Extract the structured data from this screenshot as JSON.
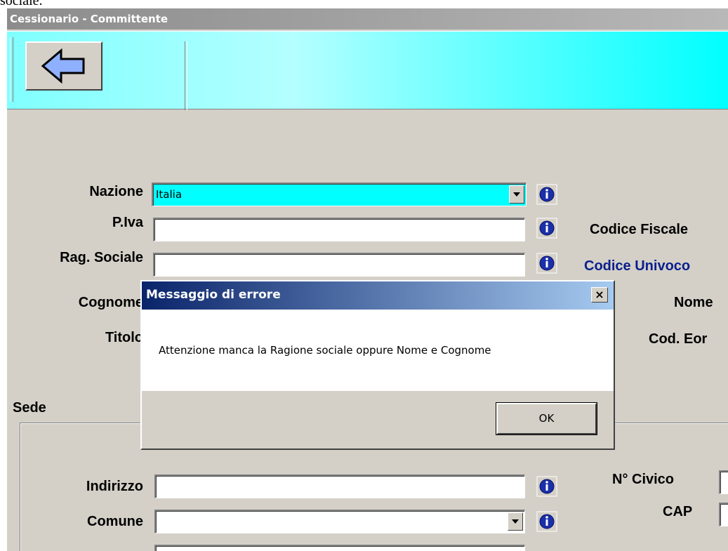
{
  "page_text": {
    "cropped_top_text": "sociale."
  },
  "window": {
    "title": "Cessionario - Committente"
  },
  "toolbar": {
    "back_icon": "back-arrow-icon"
  },
  "form": {
    "nazione_label": "Nazione",
    "nazione_value": "Italia",
    "piva_label": "P.Iva",
    "piva_value": "",
    "rag_sociale_label": "Rag. Sociale",
    "rag_sociale_value": "",
    "cognome_label": "Cognome",
    "titolo_label": "Titolo",
    "codice_fiscale_label": "Codice Fiscale",
    "codice_univoco_label": "Codice Univoco",
    "nome_label": "Nome",
    "cod_eori_label": "Cod. Eor"
  },
  "sede": {
    "label": "Sede",
    "indirizzo_label": "Indirizzo",
    "indirizzo_value": "",
    "comune_label": "Comune",
    "comune_value": "",
    "civico_label": "N° Civico",
    "cap_label": "CAP"
  },
  "dialog": {
    "title": "Messaggio di errore",
    "close_glyph": "×",
    "message": "Attenzione manca la Ragione sociale oppure Nome e Cognome",
    "ok_label": "OK"
  },
  "colors": {
    "accent_cyan": "#00ffff",
    "dialog_title_start": "#0a246a",
    "info_icon": "#1a2fa8"
  }
}
